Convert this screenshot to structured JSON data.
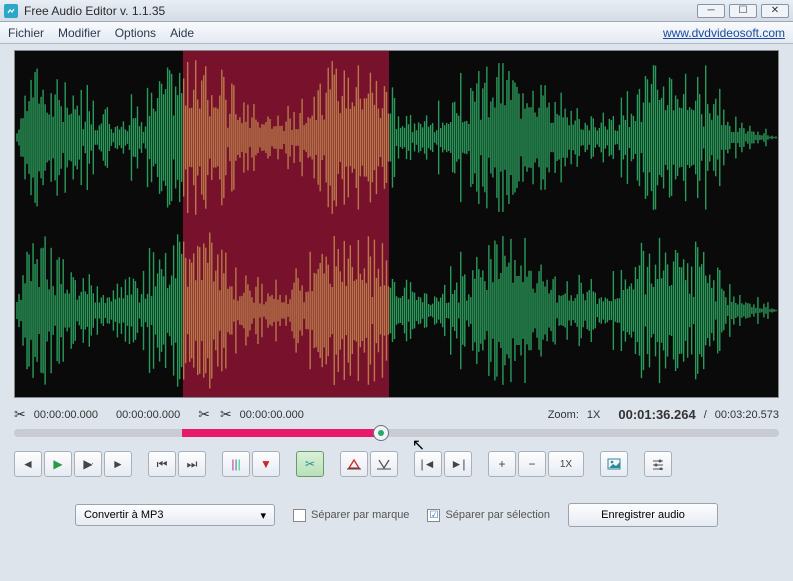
{
  "title": "Free Audio Editor v. 1.1.35",
  "menu": {
    "file": "Fichier",
    "edit": "Modifier",
    "options": "Options",
    "help": "Aide"
  },
  "link": "www.dvdvideosoft.com",
  "waveform": {
    "sel_start_pct": 22,
    "sel_end_pct": 49,
    "play_pct": 48
  },
  "info": {
    "sel_start": "00:00:00.000",
    "sel_end": "00:00:00.000",
    "cut_start": "00:00:00.000",
    "zoom_label": "Zoom:",
    "zoom_value": "1X",
    "position": "00:01:36.264",
    "sep": "/",
    "duration": "00:03:20.573"
  },
  "toolbar": {
    "zoom_reset": "1X"
  },
  "bottom": {
    "convert": "Convertir à MP3",
    "sep_mark": "Séparer par marque",
    "sep_sel": "Séparer par sélection",
    "save": "Enregistrer audio"
  }
}
